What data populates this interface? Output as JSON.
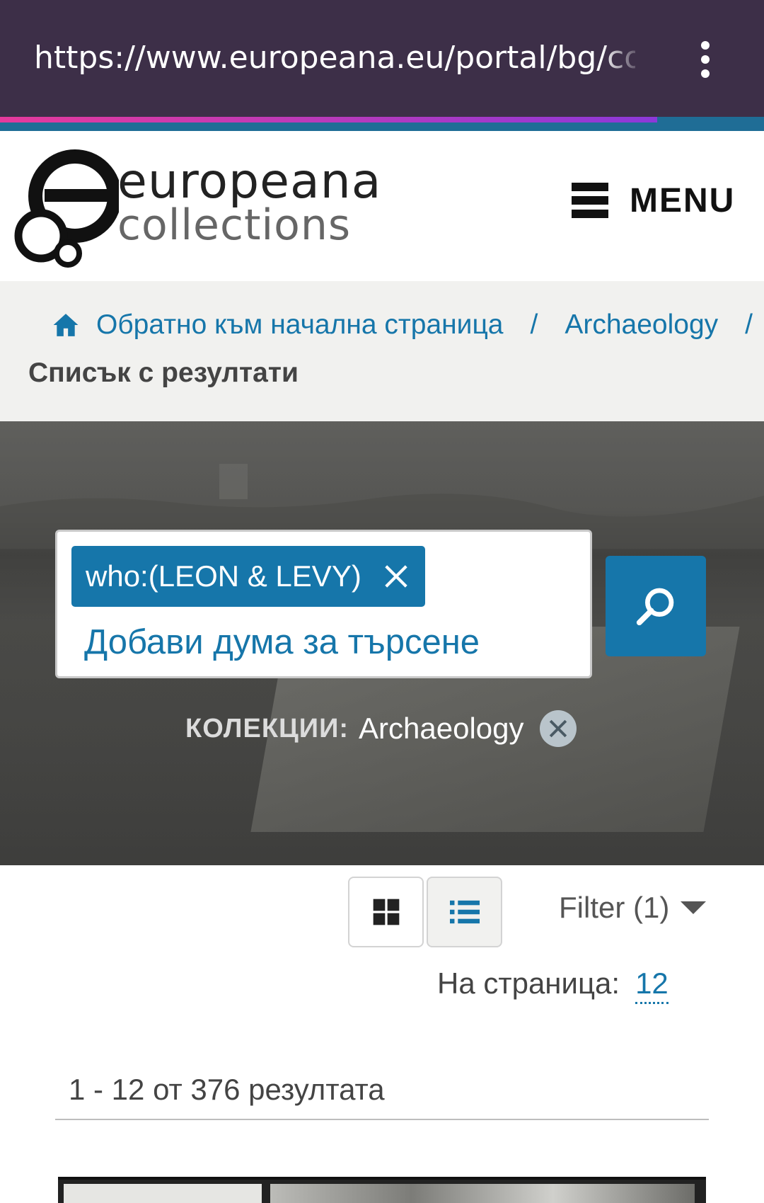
{
  "browser": {
    "url": "https://www.europeana.eu/portal/bg/colle",
    "load_progress": 0.86
  },
  "header": {
    "logo_word1": "europeana",
    "logo_word2": "collections",
    "menu_label": "MENU"
  },
  "breadcrumb": {
    "home_label": "Обратно към начална страница",
    "separator": "/",
    "collection_label": "Archaeology",
    "current": "Списък с резултати"
  },
  "search": {
    "tag_label": "who:(LEON & LEVY)",
    "placeholder": "Добави дума за търсене",
    "collection_filter_label": "КОЛЕКЦИИ:",
    "collection_filter_value": "Archaeology"
  },
  "toolbar": {
    "filter_label": "Filter (1)",
    "per_page_label": "На страница:",
    "per_page_value": "12"
  },
  "results": {
    "summary": "1 - 12 от 376 резултата"
  },
  "colors": {
    "accent": "#1676aa",
    "urlbar_bg": "#3d2f48",
    "breadcrumb_bg": "#f1f1ef"
  }
}
